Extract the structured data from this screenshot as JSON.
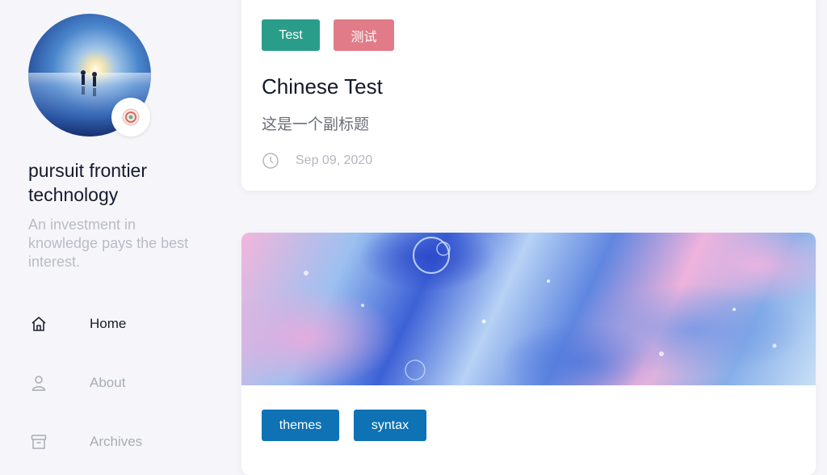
{
  "sidebar": {
    "title": "pursuit frontier technology",
    "description": "An investment in knowledge pays the best interest.",
    "nav": [
      {
        "label": "Home",
        "icon": "home-icon"
      },
      {
        "label": "About",
        "icon": "user-icon"
      },
      {
        "label": "Archives",
        "icon": "archive-icon"
      }
    ]
  },
  "posts": [
    {
      "tags": [
        "Test",
        "测试"
      ],
      "title": "Chinese Test",
      "subtitle": "这是一个副标题",
      "date": "Sep 09, 2020",
      "date_icon": "clock-icon"
    },
    {
      "tags": [
        "themes",
        "syntax"
      ]
    }
  ],
  "colors": {
    "tag_test": "#2a9d8a",
    "tag_cn": "#e07b87",
    "tag_blue": "#0e72b5",
    "background": "#f6f6fa"
  }
}
